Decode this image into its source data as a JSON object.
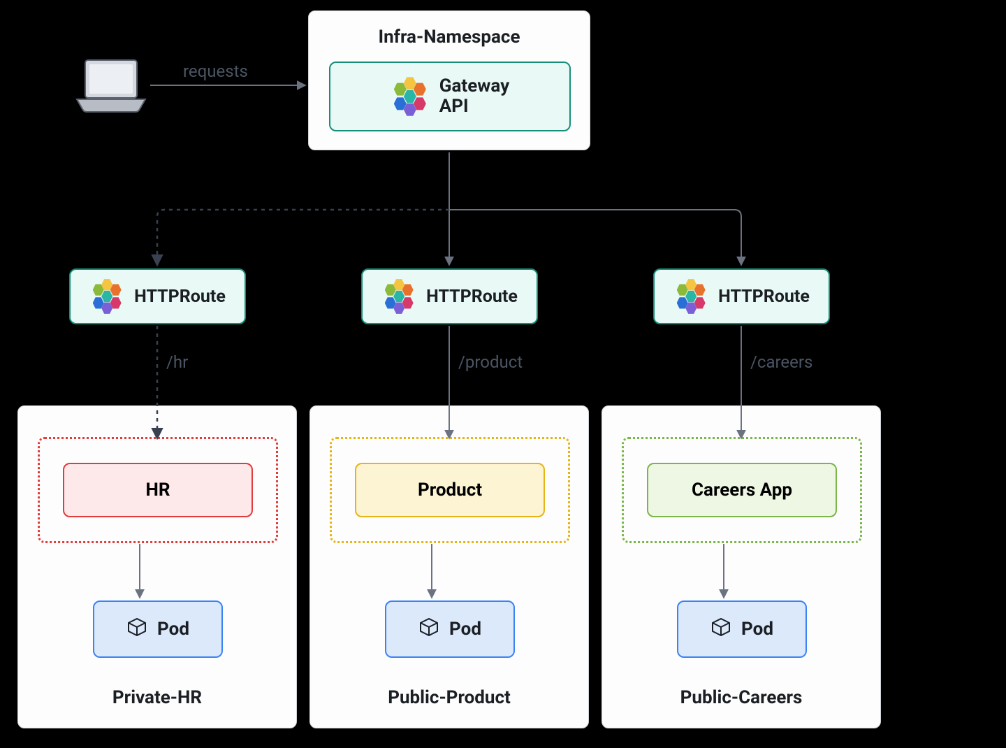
{
  "client": {
    "label": "requests"
  },
  "infra": {
    "title": "Infra-Namespace",
    "gateway": {
      "label_l1": "Gateway",
      "label_l2": "API"
    }
  },
  "routes": {
    "hr": {
      "box": "HTTPRoute",
      "path": "/hr"
    },
    "product": {
      "box": "HTTPRoute",
      "path": "/product"
    },
    "careers": {
      "box": "HTTPRoute",
      "path": "/careers"
    }
  },
  "namespaces": {
    "hr": {
      "title": "Private-HR",
      "service": "HR",
      "pod": "Pod"
    },
    "product": {
      "title": "Public-Product",
      "service": "Product",
      "pod": "Pod"
    },
    "careers": {
      "title": "Public-Careers",
      "service": "Careers App",
      "pod": "Pod"
    }
  },
  "colors": {
    "teal": "#158f7a",
    "tealFill": "#e9f9f5",
    "red": "#e23b3b",
    "redFill": "#fde8ea",
    "yellow": "#e7b416",
    "yellowFill": "#fdf4d3",
    "green": "#7ab648",
    "greenFill": "#eef7e3",
    "blue": "#3b82f6",
    "blueFill": "#dbe9fb",
    "gray": "#6b7280"
  }
}
